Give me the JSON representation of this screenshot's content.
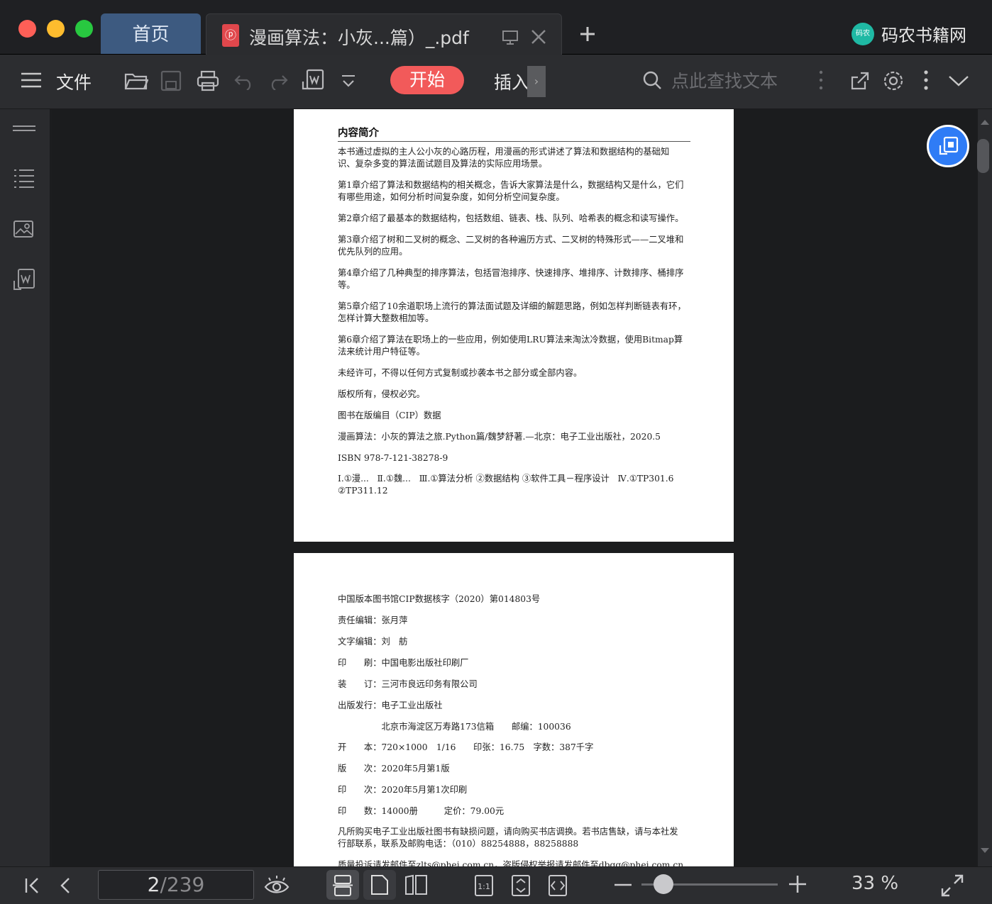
{
  "window": {
    "tabs": {
      "home": "首页",
      "document": "漫画算法：小灰...篇）_.pdf"
    },
    "brand": "码农书籍网",
    "brand_logo_text": "码农"
  },
  "toolbar": {
    "file_label": "文件",
    "start_label": "开始",
    "insert_label": "插入",
    "search_placeholder": "点此查找文本"
  },
  "page1": {
    "heading": "内容简介",
    "paragraphs": [
      "本书通过虚拟的主人公小灰的心路历程，用漫画的形式讲述了算法和数据结构的基础知\n识、复杂多变的算法面试题目及算法的实际应用场景。",
      "第1章介绍了算法和数据结构的相关概念，告诉大家算法是什么，数据结构又是什么，它们\n有哪些用途，如何分析时间复杂度，如何分析空间复杂度。",
      "第2章介绍了最基本的数据结构，包括数组、链表、栈、队列、哈希表的概念和读写操作。",
      "第3章介绍了树和二叉树的概念、二叉树的各种遍历方式、二叉树的特殊形式——二叉堆和\n优先队列的应用。",
      "第4章介绍了几种典型的排序算法，包括冒泡排序、快速排序、堆排序、计数排序、桶排序\n等。",
      "第5章介绍了10余道职场上流行的算法面试题及详细的解题思路，例如怎样判断链表有环，\n怎样计算大整数相加等。",
      "第6章介绍了算法在职场上的一些应用，例如使用LRU算法来淘汰冷数据，使用Bitmap算\n法来统计用户特征等。",
      "未经许可，不得以任何方式复制或抄袭本书之部分或全部内容。",
      "版权所有，侵权必究。",
      "图书在版编目（CIP）数据",
      "漫画算法：小灰的算法之旅.Python篇/魏梦舒著.—北京：电子工业出版社，2020.5",
      "ISBN 978-7-121-38278-9",
      "Ⅰ.①漫...   Ⅱ.①魏...   Ⅲ.①算法分析 ②数据结构 ③软件工具－程序设计   Ⅳ.①TP301.6\n②TP311.12"
    ]
  },
  "page2": {
    "lines": [
      "中国版本图书馆CIP数据核字（2020）第014803号",
      "责任编辑：张月萍",
      "文字编辑：刘　舫",
      "印　　刷：中国电影出版社印刷厂",
      "装　　订：三河市良远印务有限公司",
      "出版发行：电子工业出版社",
      "　　　　　北京市海淀区万寿路173信箱　　邮编：100036",
      "开　　本：720×1000　1/16　　印张：16.75　字数：387千字",
      "版　　次：2020年5月第1版",
      "印　　次：2020年5月第1次印刷",
      "印　　数：14000册　　　定价：79.00元",
      "凡所购买电子工业出版社图书有缺损问题，请向购买书店调换。若书店售缺，请与本社发\n行部联系，联系及邮购电话：（010）88254888，88258888",
      "质量投诉请发邮件至zlts@phei.com.cn，盗版侵权举报请发邮件至dbqq@phei.com.cn"
    ]
  },
  "status": {
    "current_page": "2",
    "total_pages": "/239",
    "zoom": "33 %",
    "zoom_level_fraction": 0.16
  }
}
